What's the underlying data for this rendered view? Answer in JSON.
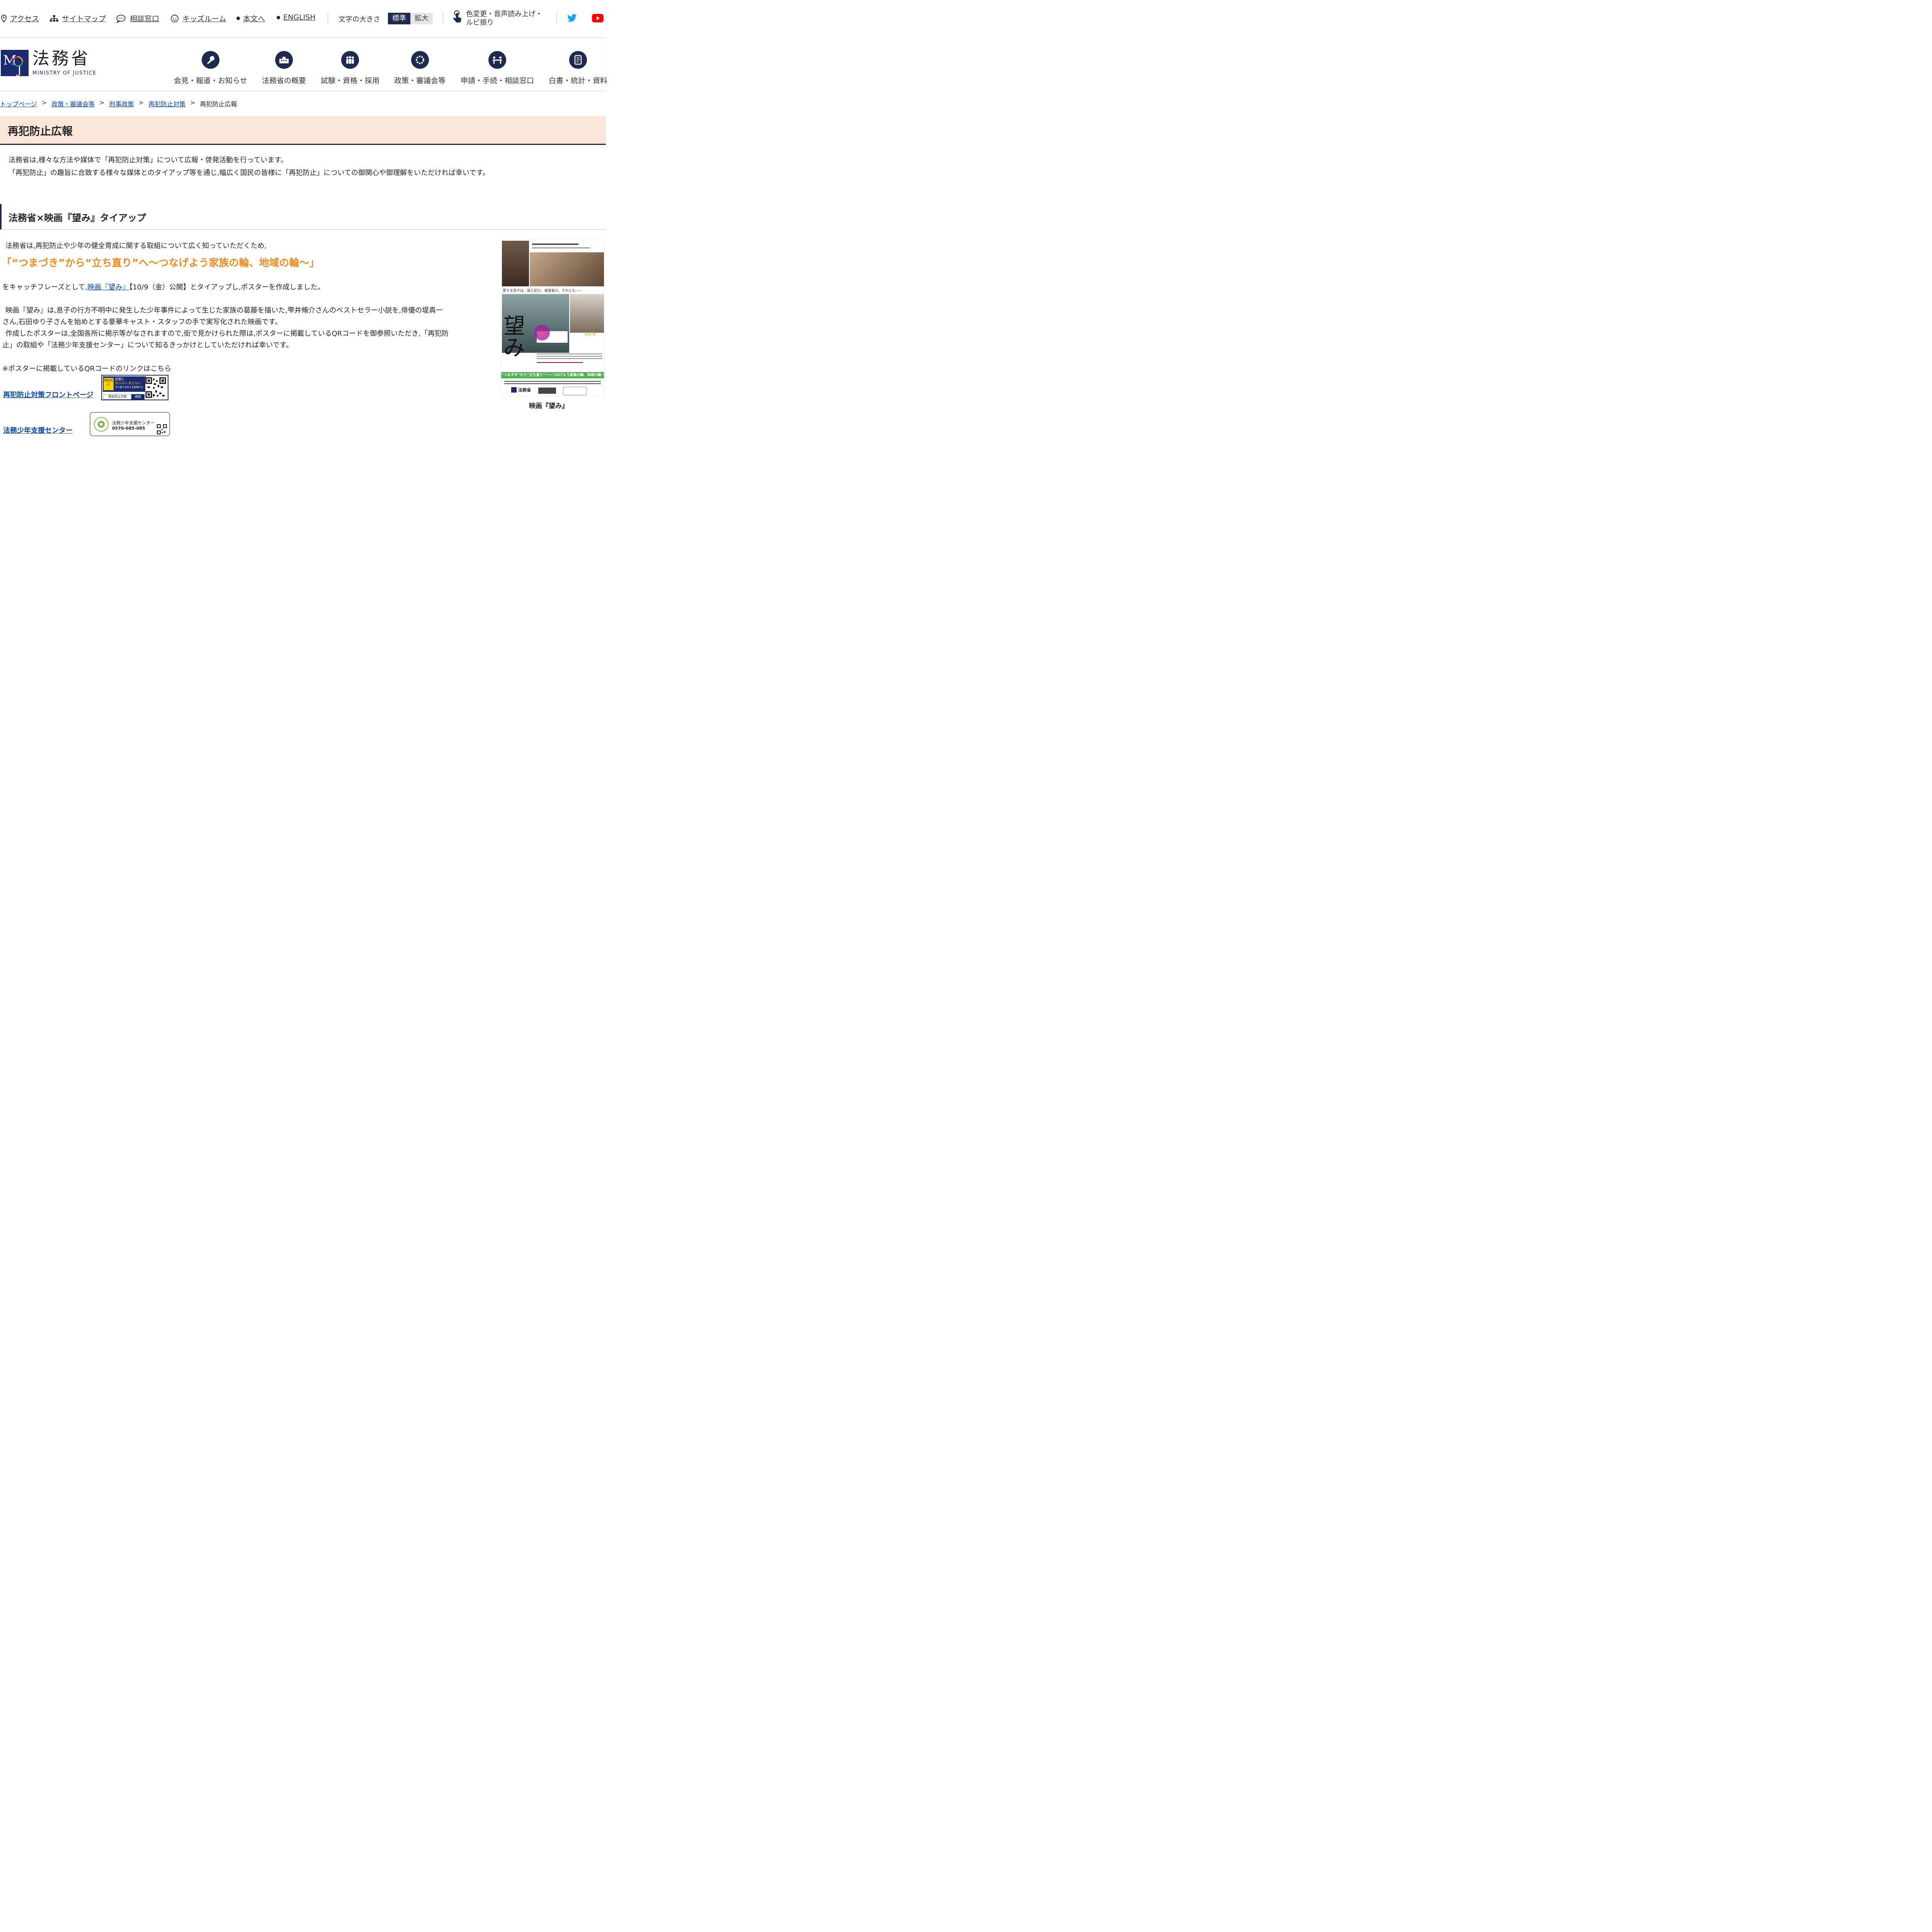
{
  "utility": {
    "links": [
      "アクセス",
      "サイトマップ",
      "相談窓口",
      "キッズルーム",
      "本文へ",
      "ENGLISH"
    ],
    "text_size_label": "文字の大きさ",
    "text_size_standard": "標準",
    "text_size_large": "拡大",
    "color_tool_line1": "色変更・音声読み上げ・",
    "color_tool_line2": "ルビ振り",
    "social": [
      "twitter-icon",
      "youtube-icon"
    ]
  },
  "header": {
    "logo_title": "法務省",
    "logo_sub": "MINISTRY OF JUSTICE",
    "logo_letters": "MJ",
    "nav": [
      "会見・報道・お知らせ",
      "法務省の概要",
      "試験・資格・採用",
      "政策・審議会等",
      "申請・手続・相談窓口",
      "白書・統計・資料"
    ]
  },
  "breadcrumb": {
    "items": [
      "トップページ",
      "政策・審議会等",
      "刑事政策",
      "再犯防止対策"
    ],
    "current": "再犯防止広報",
    "separator": ">"
  },
  "page": {
    "title": "再犯防止広報",
    "intro1": "法務省は,様々な方法や媒体で「再犯防止対策」について広報・啓発活動を行っています。",
    "intro2": "「再犯防止」の趣旨に合致する様々な媒体とのタイアップ等を通じ,幅広く国民の皆様に「再犯防止」についての御関心や御理解をいただければ幸いです。"
  },
  "section": {
    "title": "法務省×映画『望み』タイアップ",
    "lead": "法務省は,再犯防止や少年の健全育成に関する取組について広く知っていただくため,",
    "catchphrase": "「“つまづき”から“立ち直り”へ～つなげよう家族の輪、地域の輪～」",
    "para1_pre": "をキャッチフレーズとして,",
    "para1_link": "映画『望み』",
    "para1_post": "【10/9（金）公開】とタイアップし,ポスターを作成しました。",
    "para2_line1": "映画『望み』は,息子の行方不明中に発生した少年事件によって生じた家族の葛藤を描いた,雫井脩介さんのベストセラー小説を,俳優の堤真一",
    "para2_line2": "さん,石田ゆり子さんを始めとする豪華キャスト・スタッフの手で実写化された映画です。",
    "para3_line1": "作成したポスターは,全国各所に掲示等がなされますので,街で見かけられた際は,ポスターに掲載しているQRコードを御参照いただき,「再犯防",
    "para3_line2": "止」の取組や「法務少年支援センター」について知るきっかけとしていただければ幸いです。",
    "qr_note": "※ポスターに掲載しているQRコードのリンクはこちら",
    "link1": "再犯防止対策フロントページ",
    "link2": "法務少年支援センター",
    "banner1_badge": "再犯防止",
    "banner1_text1": "犯罪に",
    "banner1_text2": "戻らない 戻さない",
    "banner1_text3": "立ち直りを支える地域の力",
    "banner1_search": "再犯防止対策",
    "banner1_btn": "検索",
    "banner2_text1": "法務少年支援センター",
    "banner2_tel": "0570-085-085",
    "poster_title": "望み",
    "poster_tagline": "愛する息子は、殺人犯か、被害者か。それとも――",
    "poster_catch": "“つまずき”から“立ち直り”へ～つなげよう家族の輪、地域の輪～",
    "poster_ministry": "法務省",
    "poster_date": "10.9",
    "poster_caption": "映画『望み』"
  },
  "colors": {
    "navy": "#1b2a4e",
    "orange": "#f08a1c",
    "title_band": "#fbe7d9",
    "link": "#0645ad"
  }
}
